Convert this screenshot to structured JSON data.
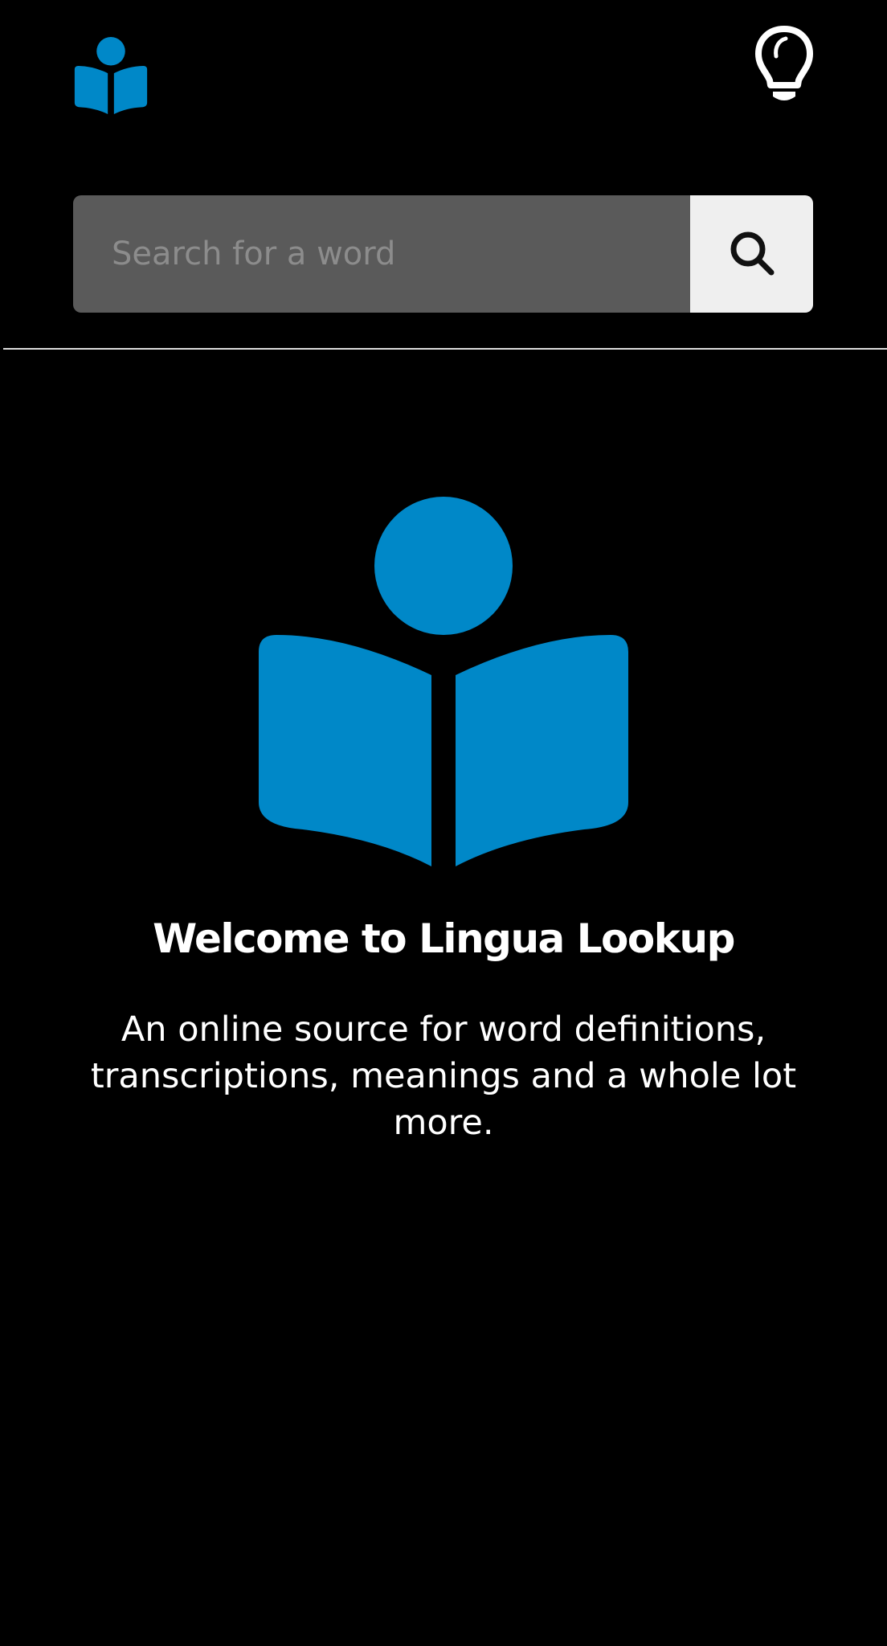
{
  "app": {
    "logo_icon": "reader-book-icon",
    "theme_toggle_icon": "lightbulb-icon",
    "brand_color": "#0088c8"
  },
  "search": {
    "placeholder": "Search for a word",
    "value": "",
    "button_icon": "search-icon"
  },
  "hero": {
    "icon": "reader-book-icon",
    "title": "Welcome to Lingua Lookup",
    "description": "An online source for word definitions, transcriptions, meanings and a whole lot more."
  }
}
